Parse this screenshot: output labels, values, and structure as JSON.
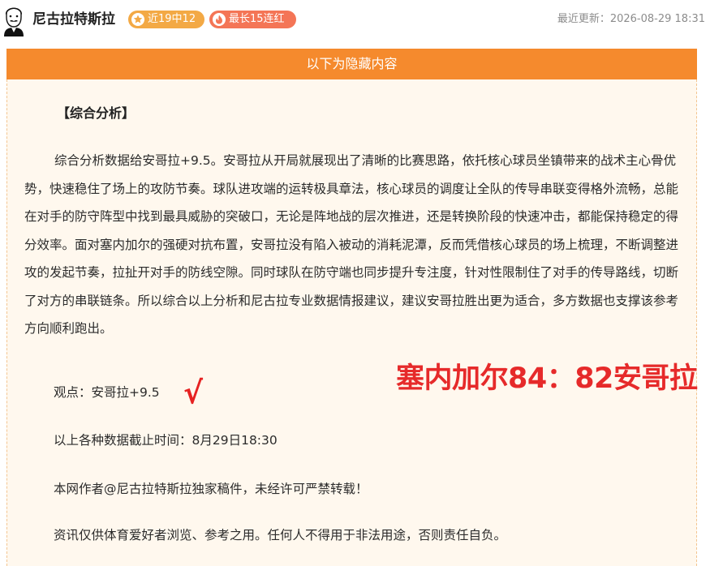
{
  "header": {
    "author_name": "尼古拉特斯拉",
    "badges": [
      {
        "label": "近19中12",
        "icon": "star-icon"
      },
      {
        "label": "最长15连红",
        "icon": "flame-icon"
      }
    ],
    "update_time": "最近更新：2026-08-29 18:31"
  },
  "hidden_banner": "以下为隐藏内容",
  "content": {
    "section_title": "【综合分析】",
    "analysis_text": "综合分析数据给安哥拉+9.5。安哥拉从开局就展现出了清晰的比赛思路，依托核心球员坐镇带来的战术主心骨优势，快速稳住了场上的攻防节奏。球队进攻端的运转极具章法，核心球员的调度让全队的传导串联变得格外流畅，总能在对手的防守阵型中找到最具威胁的突破口，无论是阵地战的层次推进，还是转换阶段的快速冲击，都能保持稳定的得分效率。面对塞内加尔的强硬对抗布置，安哥拉没有陷入被动的消耗泥潭，反而凭借核心球员的场上梳理，不断调整进攻的发起节奏，拉扯开对手的防线空隙。同时球队在防守端也同步提升专注度，针对性限制住了对手的传导路线，切断了对方的串联链条。所以综合以上分析和尼古拉专业数据情报建议，建议安哥拉胜出更为适合，多方数据也支撑该参考方向顺利跑出。",
    "viewpoint": "观点：安哥拉+9.5",
    "check_mark": "√",
    "score_stamp": "塞内加尔84：82安哥拉",
    "cutoff_time": "以上各种数据截止时间：8月29日18:30",
    "copyright": "本网作者@尼古拉特斯拉独家稿件，未经许可严禁转载！",
    "disclaimer": "资讯仅供体育爱好者浏览、参考之用。任何人不得用于非法用途，否则责任自负。"
  },
  "colors": {
    "banner_orange": "#f58a2d",
    "content_bg": "#fff8ee",
    "badge_record": "#f3a945",
    "badge_streak": "#f47556",
    "stamp_red": "#e62a2a"
  }
}
